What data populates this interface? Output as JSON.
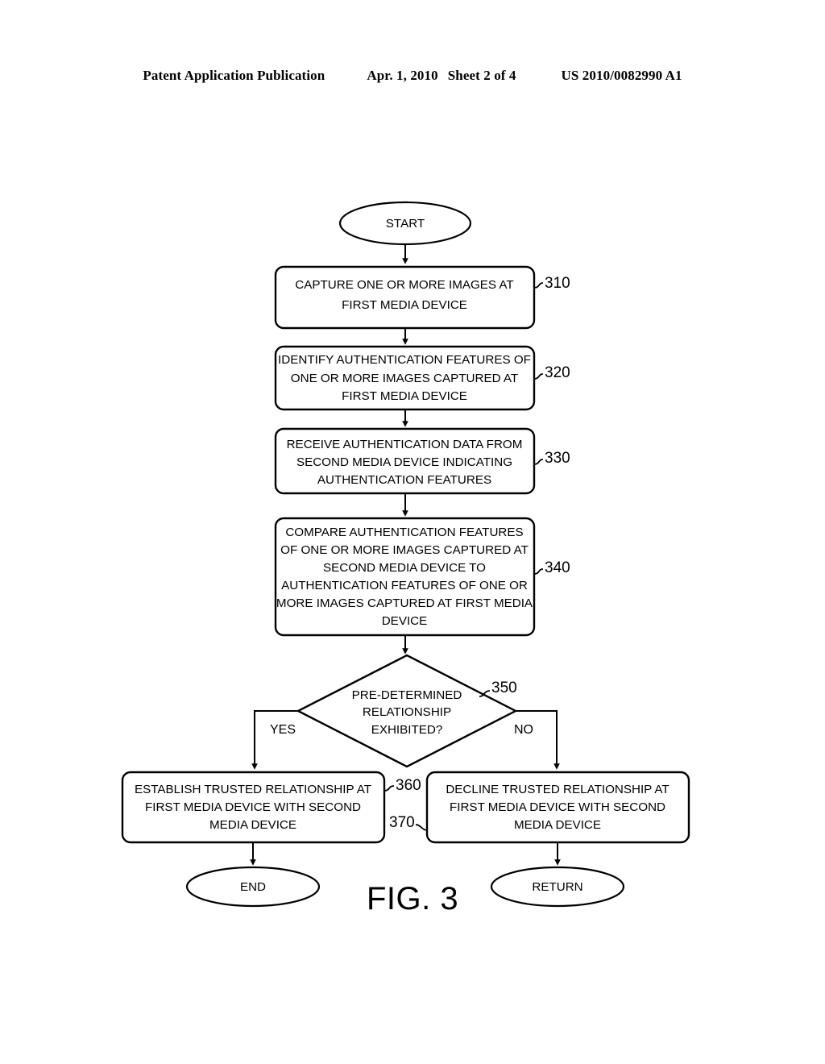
{
  "header": {
    "publication": "Patent Application Publication",
    "date": "Apr. 1, 2010",
    "sheet": "Sheet 2 of 4",
    "doc_number": "US 2010/0082990 A1"
  },
  "figure": {
    "caption": "FIG. 3",
    "start_label": "START",
    "end_label": "END",
    "return_label": "RETURN",
    "yes_label": "YES",
    "no_label": "NO",
    "steps": [
      {
        "ref": "310",
        "lines": [
          "CAPTURE ONE OR MORE IMAGES AT",
          "FIRST MEDIA DEVICE"
        ]
      },
      {
        "ref": "320",
        "lines": [
          "IDENTIFY AUTHENTICATION FEATURES OF",
          "ONE OR MORE IMAGES CAPTURED AT",
          "FIRST MEDIA DEVICE"
        ]
      },
      {
        "ref": "330",
        "lines": [
          "RECEIVE AUTHENTICATION DATA FROM",
          "SECOND MEDIA DEVICE INDICATING",
          "AUTHENTICATION FEATURES"
        ]
      },
      {
        "ref": "340",
        "lines": [
          "COMPARE AUTHENTICATION FEATURES",
          "OF ONE OR MORE IMAGES CAPTURED AT",
          "SECOND MEDIA DEVICE TO",
          "AUTHENTICATION FEATURES OF ONE OR",
          "MORE IMAGES CAPTURED AT FIRST MEDIA",
          "DEVICE"
        ]
      },
      {
        "ref": "350",
        "lines": [
          "PRE-DETERMINED",
          "RELATIONSHIP",
          "EXHIBITED?"
        ]
      },
      {
        "ref": "360",
        "lines": [
          "ESTABLISH TRUSTED RELATIONSHIP AT",
          "FIRST MEDIA DEVICE WITH SECOND",
          "MEDIA DEVICE"
        ]
      },
      {
        "ref": "370",
        "lines": [
          "DECLINE TRUSTED RELATIONSHIP AT",
          "FIRST MEDIA DEVICE WITH SECOND",
          "MEDIA DEVICE"
        ]
      }
    ]
  }
}
